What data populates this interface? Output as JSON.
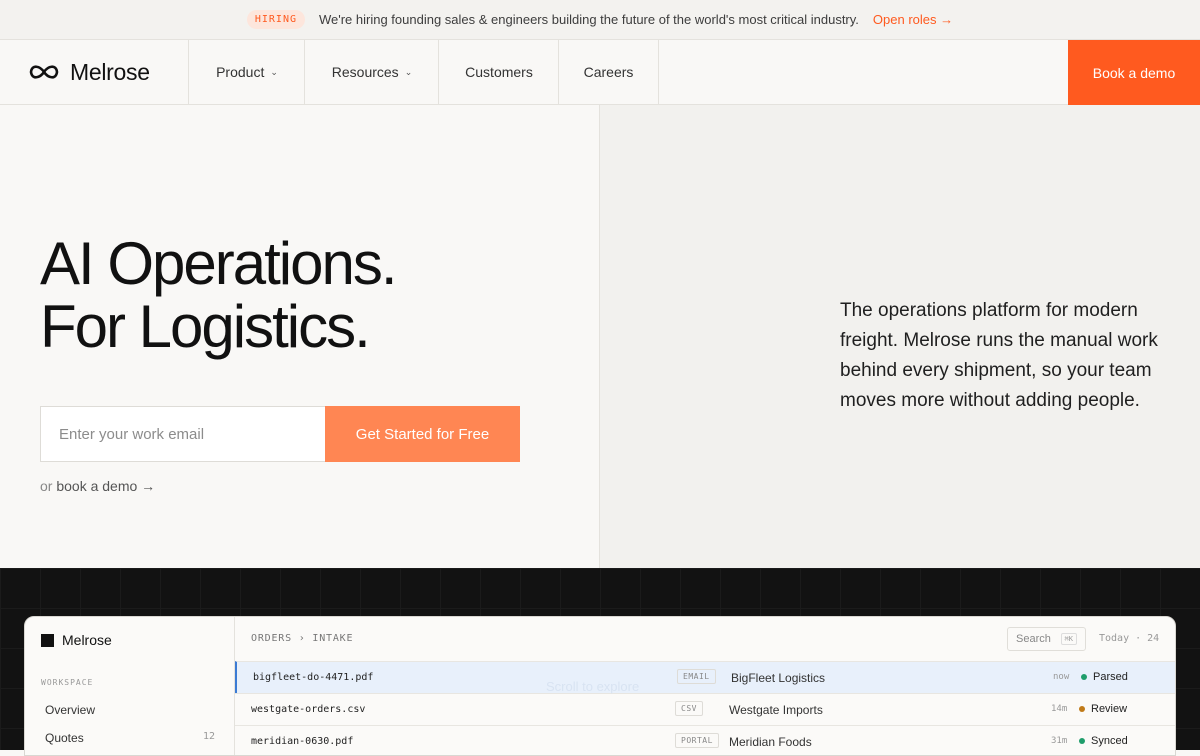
{
  "announcement": {
    "badge": "HIRING",
    "text": "We're hiring founding sales & engineers building the future of the world's most critical industry.",
    "link": "Open roles →"
  },
  "nav": {
    "logo": "Melrose",
    "items": [
      {
        "label": "Product",
        "has_dropdown": true
      },
      {
        "label": "Resources",
        "has_dropdown": true
      },
      {
        "label": "Customers",
        "has_dropdown": false
      },
      {
        "label": "Careers",
        "has_dropdown": false
      }
    ],
    "cta": "Book a demo"
  },
  "hero": {
    "headline_line1": "AI Operations.",
    "headline_line2": "For Logistics.",
    "email_placeholder": "Enter your work email",
    "cta": "Get Started for Free",
    "or_text": "or",
    "demo_link": "book a demo →",
    "description": "The operations platform for modern freight. Melrose runs the manual work behind every shipment, so your team moves more without adding people."
  },
  "app": {
    "logo": "Melrose",
    "workspace_label": "WORKSPACE",
    "sidebar": [
      {
        "label": "Overview",
        "count": ""
      },
      {
        "label": "Quotes",
        "count": "12"
      }
    ],
    "breadcrumb": "ORDERS › INTAKE",
    "search_placeholder": "Search",
    "search_shortcut": "⌘K",
    "today": "Today · 24",
    "rows": [
      {
        "file": "bigfleet-do-4471.pdf",
        "source": "EMAIL",
        "customer": "BigFleet Logistics",
        "time": "now",
        "status": "Parsed",
        "status_color": "#1f9d6b"
      },
      {
        "file": "westgate-orders.csv",
        "source": "CSV",
        "customer": "Westgate Imports",
        "time": "14m",
        "status": "Review",
        "status_color": "#c07a18"
      },
      {
        "file": "meridian-0630.pdf",
        "source": "PORTAL",
        "customer": "Meridian Foods",
        "time": "31m",
        "status": "Synced",
        "status_color": "#1f9d6b"
      }
    ]
  },
  "scroll_hint": "Scroll to explore",
  "colors": {
    "accent": "#ff5a1f",
    "cta_light": "#ff8653",
    "dark_bg": "#121212"
  }
}
